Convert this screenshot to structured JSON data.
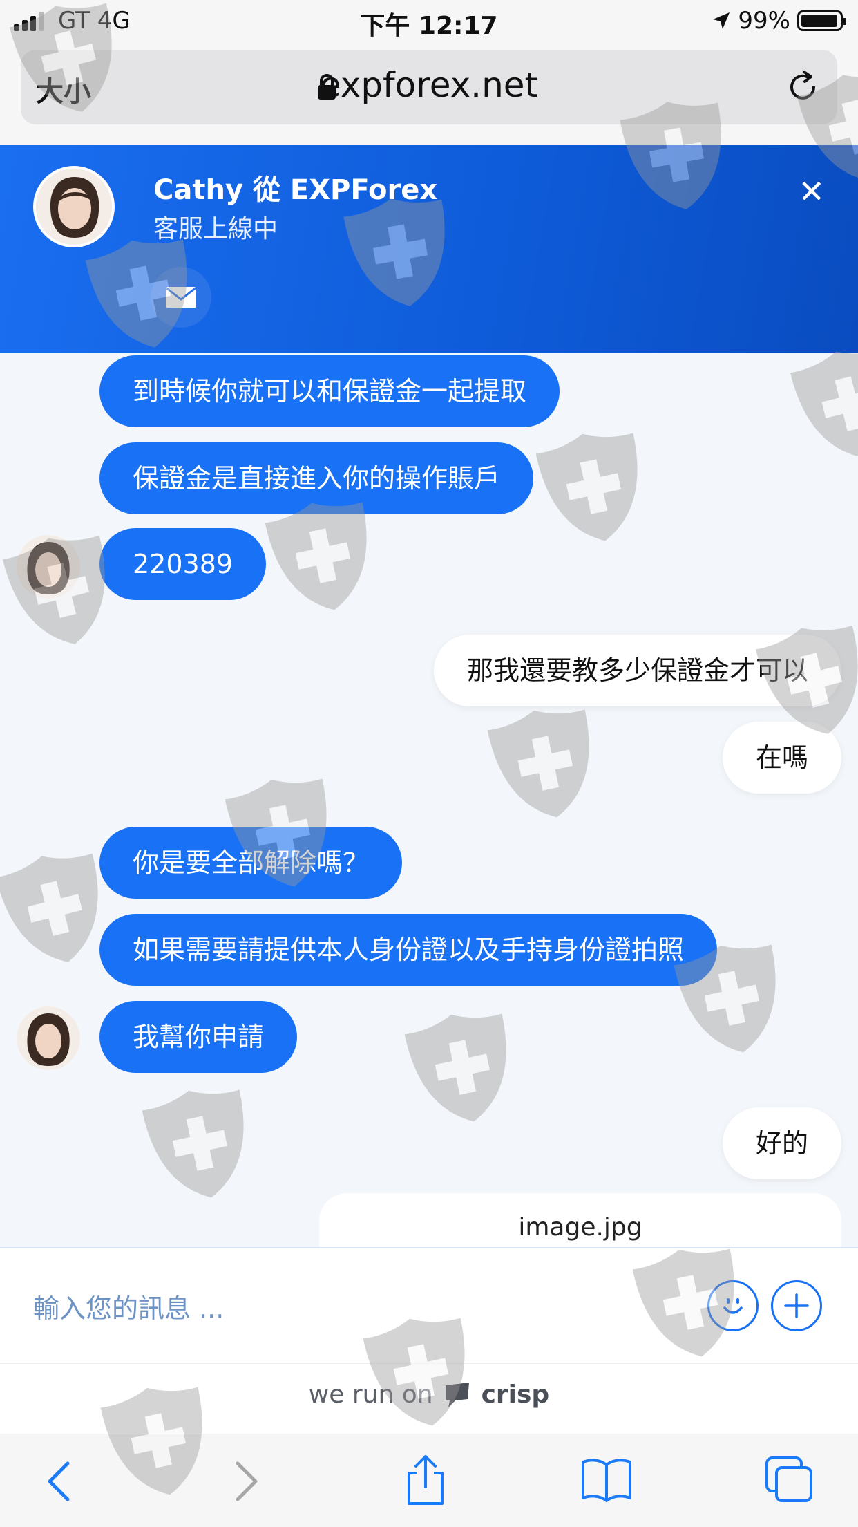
{
  "status_bar": {
    "carrier": "GT  4G",
    "time": "下午 12:17",
    "battery": "99%"
  },
  "browser": {
    "text_size": "大小",
    "domain": "expforex.net"
  },
  "chat_header": {
    "title": "Cathy 從 EXPForex",
    "subtitle": "客服上線中"
  },
  "messages": [
    {
      "from": "operator",
      "text": "到時候你就可以和保證金一起提取"
    },
    {
      "from": "operator",
      "text": "保證金是直接進入你的操作賬戶"
    },
    {
      "from": "operator",
      "text": "220389"
    },
    {
      "from": "user",
      "text": "那我還要教多少保證金才可以"
    },
    {
      "from": "user",
      "text": "在嗎"
    },
    {
      "from": "operator",
      "text": "你是要全部解除嗎？"
    },
    {
      "from": "operator",
      "text": "如果需要請提供本人身份證以及手持身份證拍照"
    },
    {
      "from": "operator",
      "text": "我幫你申請"
    },
    {
      "from": "user",
      "text": "好的"
    },
    {
      "from": "user",
      "file": "image.jpg"
    }
  ],
  "composer": {
    "placeholder": "輸入您的訊息 ..."
  },
  "footer": {
    "prefix": "we run on",
    "brand": "crisp"
  },
  "colors": {
    "accent": "#1972f5",
    "header_bg": "#0e5bd8",
    "page_bg": "#f3f6fa"
  },
  "icons": [
    "signal-icon",
    "lock-icon",
    "reload-icon",
    "close-icon",
    "mail-icon",
    "emoji-icon",
    "plus-icon",
    "back-icon",
    "forward-icon",
    "share-icon",
    "bookmarks-icon",
    "tabs-icon"
  ]
}
